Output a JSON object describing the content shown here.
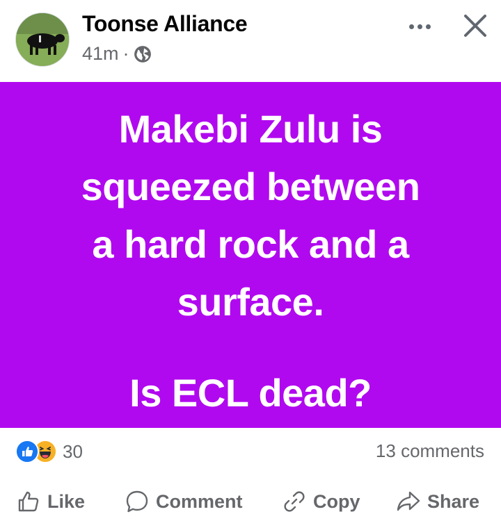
{
  "post": {
    "author": "Toonse Alliance",
    "time": "41m",
    "separator": "·",
    "privacy_icon": "globe-icon",
    "menu_icon": "more-horizontal-icon",
    "close_icon": "close-icon"
  },
  "banner": {
    "background": "#b109ef",
    "text_color": "#ffffff",
    "lines": [
      "Makebi Zulu is",
      "squeezed between",
      "a hard rock and a",
      "surface."
    ],
    "question": "Is ECL dead?"
  },
  "stats": {
    "reaction_icons": [
      "like-icon",
      "haha-icon"
    ],
    "reaction_count": "30",
    "comments": "13 comments"
  },
  "actions": {
    "like": "Like",
    "comment": "Comment",
    "copy": "Copy",
    "share": "Share"
  }
}
